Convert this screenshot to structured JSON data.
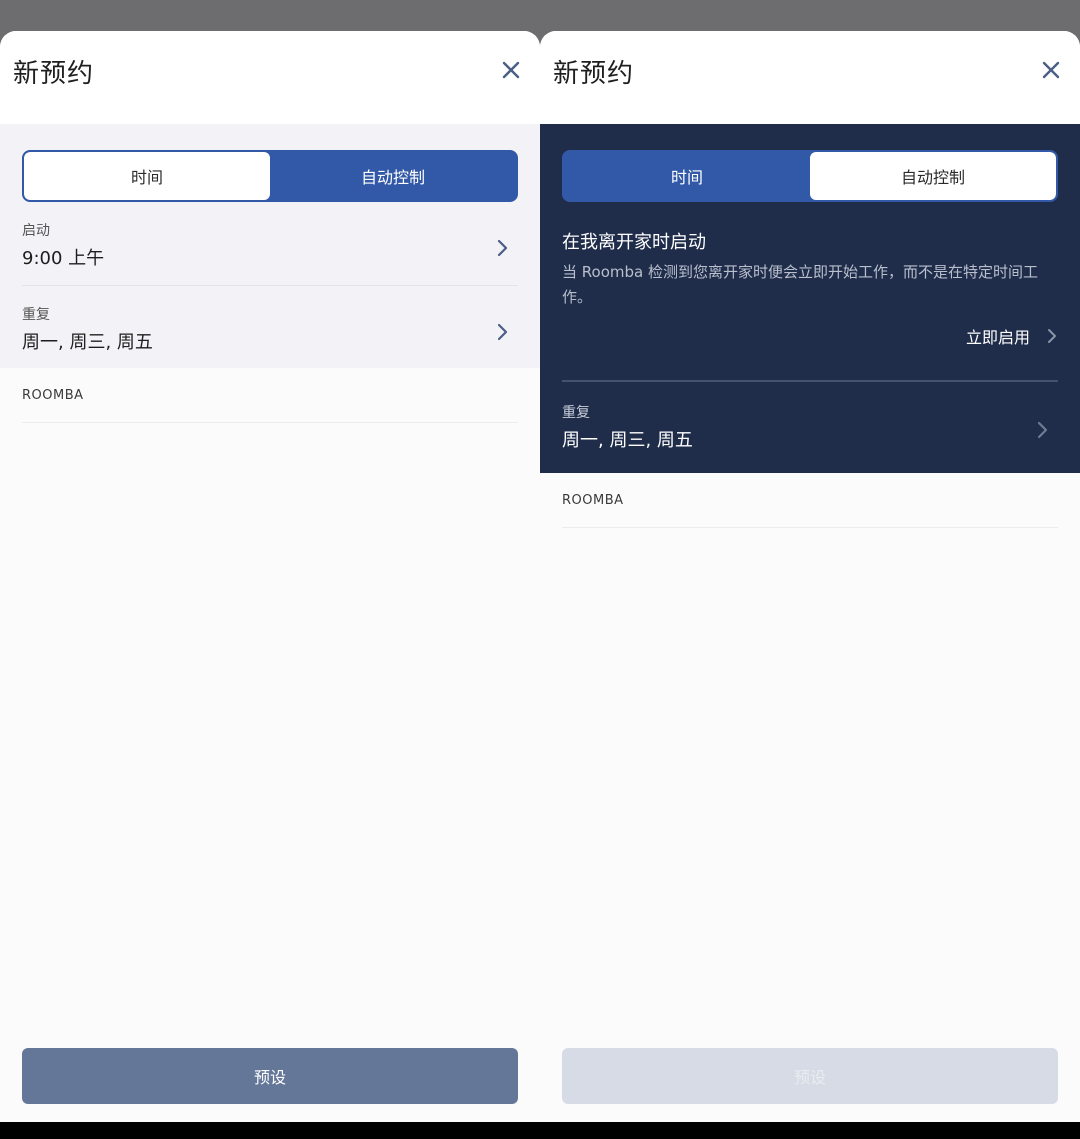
{
  "left_screen": {
    "title": "新预约",
    "segment": {
      "time_label": "时间",
      "auto_label": "自动控制",
      "selected": "时间"
    },
    "start": {
      "label": "启动",
      "value": "9:00 上午"
    },
    "repeat": {
      "label": "重复",
      "value": "周一, 周三, 周五"
    },
    "section_label": "ROOMBA",
    "primary_button": "预设"
  },
  "right_screen": {
    "title": "新预约",
    "segment": {
      "time_label": "时间",
      "auto_label": "自动控制",
      "selected": "自动控制"
    },
    "auto_title": "在我离开家时启动",
    "auto_description": "当 Roomba 检测到您离开家时便会立即开始工作，而不是在特定时间工作。",
    "enable_now": "立即启用",
    "repeat": {
      "label": "重复",
      "value": "周一, 周三, 周五"
    },
    "section_label": "ROOMBA",
    "primary_button": "预设"
  },
  "colors": {
    "accent": "#3259a8",
    "dark_panel": "#1f2d4b",
    "button_enabled": "#657799",
    "button_disabled": "#d6dbe5"
  },
  "icons": [
    "close-icon",
    "chevron-right-icon"
  ]
}
